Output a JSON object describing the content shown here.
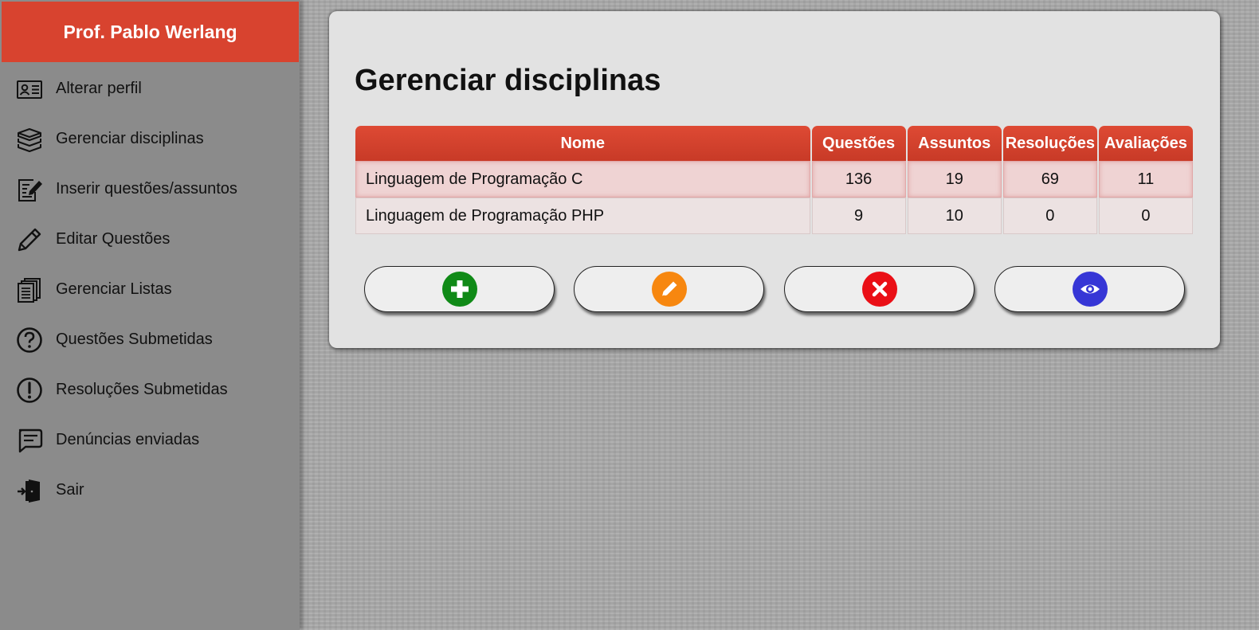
{
  "sidebar": {
    "title": "Prof. Pablo Werlang",
    "items": [
      {
        "label": "Alterar perfil",
        "icon": "id-card-icon"
      },
      {
        "label": "Gerenciar disciplinas",
        "icon": "books-stack-icon"
      },
      {
        "label": "Inserir questões/assuntos",
        "icon": "edit-document-icon"
      },
      {
        "label": "Editar Questões",
        "icon": "pencil-icon"
      },
      {
        "label": "Gerenciar Listas",
        "icon": "documents-icon"
      },
      {
        "label": "Questões Submetidas",
        "icon": "question-circle-icon"
      },
      {
        "label": "Resoluções Submetidas",
        "icon": "exclamation-circle-icon"
      },
      {
        "label": "Denúncias enviadas",
        "icon": "message-icon"
      },
      {
        "label": "Sair",
        "icon": "exit-door-icon"
      }
    ]
  },
  "main": {
    "title": "Gerenciar disciplinas",
    "table": {
      "headers": [
        "Nome",
        "Questões",
        "Assuntos",
        "Resoluções",
        "Avaliações"
      ],
      "rows": [
        [
          "Linguagem de Programação C",
          "136",
          "19",
          "69",
          "11"
        ],
        [
          "Linguagem de Programação PHP",
          "9",
          "10",
          "0",
          "0"
        ]
      ]
    },
    "actions": [
      {
        "name": "add",
        "icon": "plus-icon",
        "color": "#108a17"
      },
      {
        "name": "edit",
        "icon": "pencil-icon",
        "color": "#f7870f"
      },
      {
        "name": "delete",
        "icon": "close-icon",
        "color": "#ea0f16"
      },
      {
        "name": "view",
        "icon": "eye-icon",
        "color": "#3636d6"
      }
    ]
  },
  "colors": {
    "accent": "#d8432f",
    "sidebar_bg": "#8b8b8b",
    "panel_bg": "#e2e2e2"
  }
}
